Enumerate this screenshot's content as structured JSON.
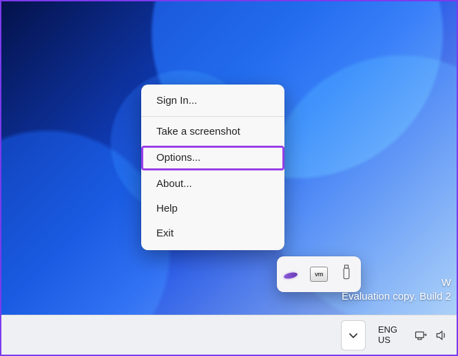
{
  "context_menu": {
    "sign_in": "Sign In...",
    "take_screenshot": "Take a screenshot",
    "options": "Options...",
    "about": "About...",
    "help": "Help",
    "exit": "Exit"
  },
  "watermark": {
    "line1": "W",
    "line2": "Evaluation copy. Build 2"
  },
  "taskbar": {
    "language_primary": "ENG",
    "language_secondary": "US"
  },
  "tray_flyout": {
    "vm_label": "vm"
  }
}
